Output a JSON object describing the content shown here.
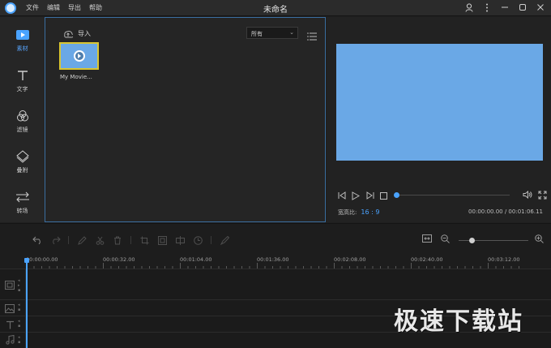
{
  "titlebar": {
    "menu": [
      "文件",
      "编辑",
      "导出",
      "帮助"
    ],
    "title": "未命名"
  },
  "sidebar": {
    "items": [
      {
        "label": "素材",
        "icon": "media-play-icon",
        "active": true
      },
      {
        "label": "文字",
        "icon": "text-t-icon"
      },
      {
        "label": "滤镜",
        "icon": "filter-circles-icon"
      },
      {
        "label": "叠附",
        "icon": "overlay-diamond-icon"
      },
      {
        "label": "转场",
        "icon": "transition-arrows-icon"
      }
    ]
  },
  "media": {
    "import_label": "导入",
    "filter_value": "所有",
    "clip_label": "My Movie..."
  },
  "preview": {
    "ratio_label": "宽高比:",
    "ratio_value": "16 : 9",
    "timecode": "00:00:00.00 / 00:01:06.11"
  },
  "ruler": {
    "labels": [
      "00:00:00.00",
      "00:00:32.00",
      "00:01:04.00",
      "00:01:36.00",
      "00:02:08.00",
      "00:02:40.00",
      "00:03:12.00"
    ]
  },
  "watermark": "极速下载站",
  "colors": {
    "accent": "#4aa3ff",
    "preview": "#6aa8e6",
    "selection": "#d9c531"
  }
}
